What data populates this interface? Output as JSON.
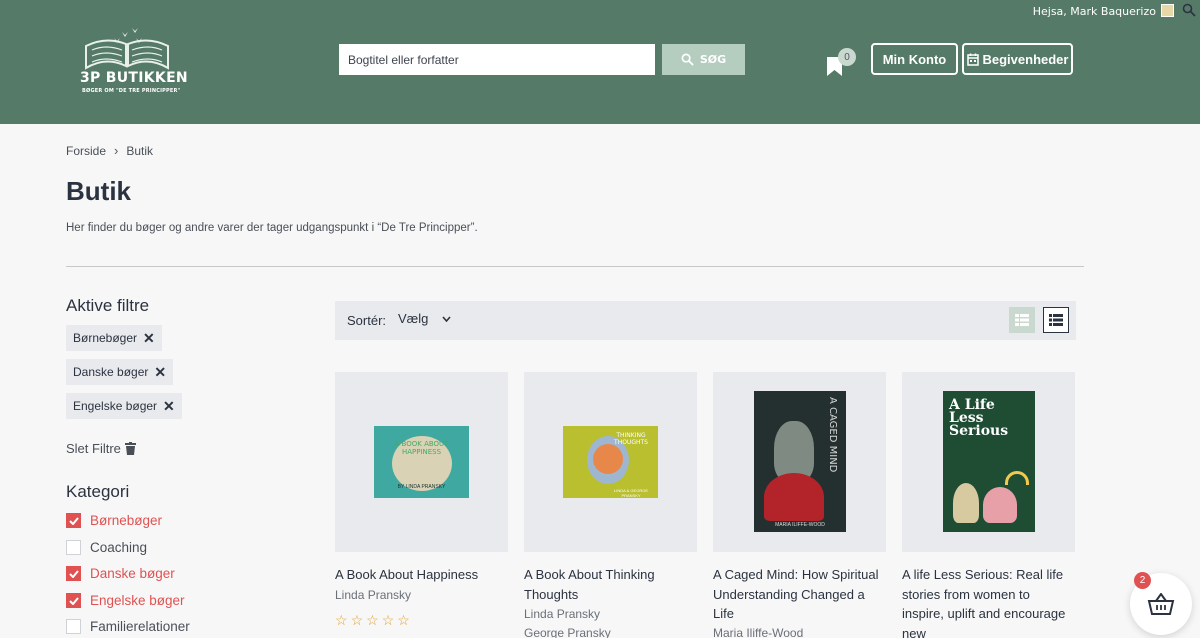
{
  "header": {
    "greeting": "Hejsa, Mark Baquerizo",
    "logo_title": "3P BUTIKKEN",
    "logo_subtitle": "BØGER OM \"DE TRE PRINCIPPER\"",
    "search_placeholder": "Bogtitel eller forfatter",
    "search_button": "SØG",
    "wishlist_count": "0",
    "account_button": "Min Konto",
    "events_button": "Begivenheder"
  },
  "breadcrumb": [
    "Forside",
    "Butik"
  ],
  "page": {
    "title": "Butik",
    "description": "Her finder du bøger og andre varer der tager udgangspunkt i “De Tre Principper”."
  },
  "filters": {
    "heading": "Aktive filtre",
    "active": [
      "Børnebøger",
      "Danske bøger",
      "Engelske bøger"
    ],
    "clear_label": "Slet Filtre"
  },
  "category": {
    "heading": "Kategori",
    "items": [
      {
        "label": "Børnebøger",
        "checked": true
      },
      {
        "label": "Coaching",
        "checked": false
      },
      {
        "label": "Danske bøger",
        "checked": true
      },
      {
        "label": "Engelske bøger",
        "checked": true
      },
      {
        "label": "Familierelationer",
        "checked": false
      }
    ]
  },
  "toolbar": {
    "sort_label": "Sortér:",
    "sort_value": "Vælg"
  },
  "products": [
    {
      "title": "A Book About Happiness",
      "authors": [
        "Linda Pransky"
      ],
      "cover_title": "A BOOK ABOUT HAPPINESS",
      "cover_author": "BY LINDA PRANSKY",
      "rating": 0
    },
    {
      "title": "A Book About Thinking Thoughts",
      "authors": [
        "Linda Pransky",
        "George Pransky"
      ],
      "cover_title": "THINKING THOUGHTS",
      "cover_author": "LINDA & GEORGE PRANSKY"
    },
    {
      "title": "A Caged Mind: How Spiritual Understanding Changed a Life",
      "authors": [
        "Maria Iliffe-Wood"
      ],
      "cover_title": "A CAGED MIND",
      "cover_author": "MARIA ILIFFE-WOOD"
    },
    {
      "title": "A life Less Serious: Real life stories from women to inspire, uplift and encourage new",
      "authors": [],
      "cover_title": "A Life Less Serious"
    }
  ],
  "basket": {
    "count": "2"
  },
  "colors": {
    "header_bg": "#557a68",
    "accent_red": "#e05252",
    "panel_grey": "#e9eaed"
  }
}
